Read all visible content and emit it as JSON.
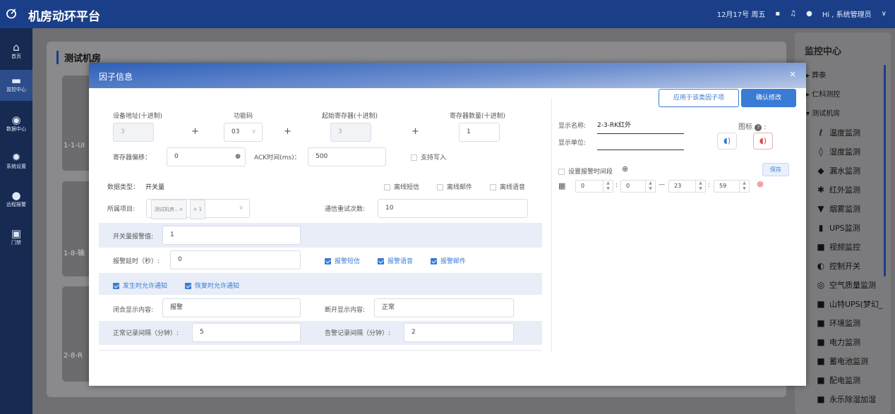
{
  "app": {
    "title": "机房动环平台",
    "date": "12月17号 周五",
    "user": "Hi , 系统管理员"
  },
  "sidebar": {
    "items": [
      {
        "label": "首页",
        "icon": "home-icon"
      },
      {
        "label": "监控中心",
        "icon": "monitor-icon"
      },
      {
        "label": "数据中心",
        "icon": "data-icon"
      },
      {
        "label": "系统设置",
        "icon": "gear-icon"
      },
      {
        "label": "远程报警",
        "icon": "bulb-icon"
      },
      {
        "label": "门禁",
        "icon": "door-icon"
      }
    ]
  },
  "background": {
    "panel_title": "测试机房",
    "cards": [
      "1-1-UI",
      "1-8-输",
      "2-8-R"
    ]
  },
  "right_panel": {
    "title": "监控中心",
    "groups": [
      "葬泰",
      "仁科测控",
      "测试机房"
    ],
    "items": [
      "温度监测",
      "湿度监测",
      "漏水监测",
      "红外监测",
      "烟雾监测",
      "UPS监测",
      "视频监控",
      "控制开关",
      "空气质量监测",
      "山特UPS(梦幻_",
      "环境监测",
      "电力监测",
      "蓄电池监测",
      "配电监测",
      "永乐除湿加湿"
    ]
  },
  "modal": {
    "title": "因子信息",
    "close": "×",
    "apply_button": "应用于该类因子项",
    "confirm_button": "确认修改",
    "device_addr_label": "设备地址(十进制)",
    "device_addr_value": "3",
    "func_code_label": "功能码",
    "func_code_value": "03",
    "start_reg_label": "起始寄存器(十进制)",
    "start_reg_value": "3",
    "reg_count_label": "寄存器数量(十进制)",
    "reg_count_value": "1",
    "plus": "+",
    "reg_offset_label": "寄存器偏移：",
    "reg_offset_value": "0",
    "ack_label": "ACK时间(ms)：",
    "ack_value": "500",
    "support_write": "支持写入",
    "data_type_label": "数据类型：",
    "data_type_value": "开关量",
    "offline_sms": "离线短信",
    "offline_mail": "离线邮件",
    "offline_voice": "离线语音",
    "project_label": "所属项目:",
    "project_tag": "测试机房...×",
    "project_more": "+ 1",
    "retry_label": "通信重试次数:",
    "retry_value": "10",
    "alarm_value_label": "开关量报警值:",
    "alarm_value": "1",
    "alarm_delay_label": "报警延时（秒）:",
    "alarm_delay_value": "0",
    "alarm_sms": "报警短信",
    "alarm_voice": "报警语音",
    "alarm_mail": "报警邮件",
    "notify_on": "发生时允许通知",
    "notify_recover": "恢复时允许通知",
    "close_text_label": "闭合显示内容:",
    "close_text_value": "报警",
    "open_text_label": "断开显示内容:",
    "open_text_value": "正常",
    "normal_interval_label": "正常记录间隔（分钟）:",
    "normal_interval_value": "5",
    "alarm_interval_label": "告警记录间隔（分钟）:",
    "alarm_interval_value": "2",
    "display_name_label": "显示名称:",
    "display_name_value": "2-3-RK红外",
    "display_unit_label": "显示单位:",
    "display_unit_value": "",
    "icon_label": "图标",
    "icon_help": "?",
    "icon_colon": ":",
    "period_label": "设置报警时间段",
    "save_button": "保存",
    "time_start_h": "0",
    "time_start_m": "0",
    "time_end_h": "23",
    "time_end_m": "59",
    "dash": "—",
    "colon": ":"
  }
}
